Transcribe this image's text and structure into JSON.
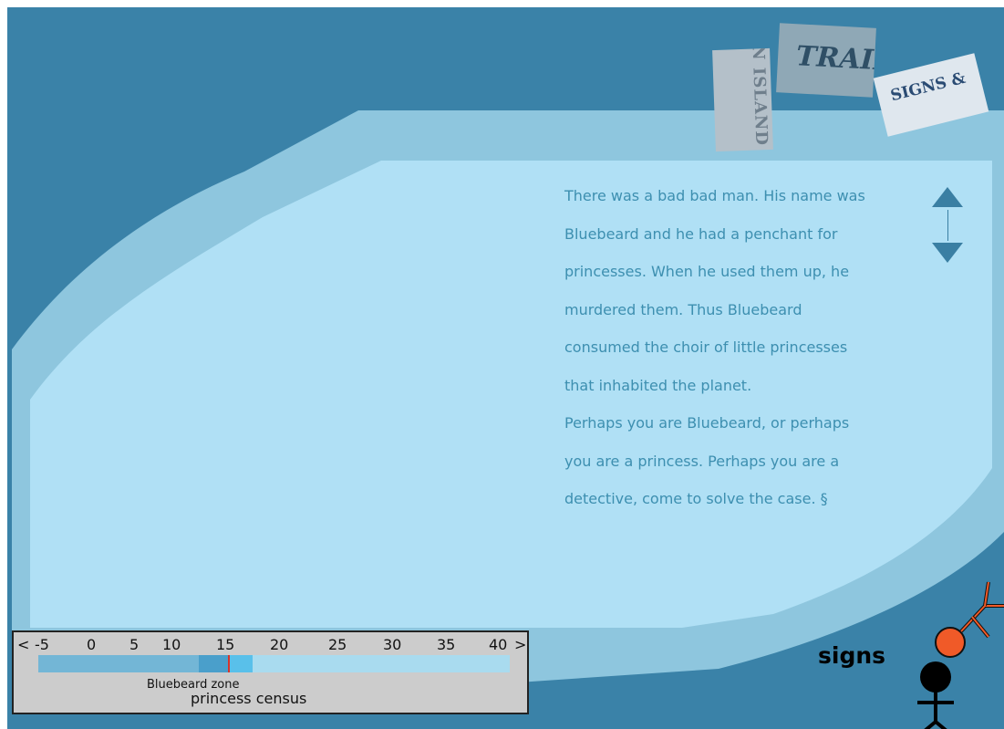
{
  "story": {
    "text": "There was a bad bad man. His name was\nBluebeard and he had a penchant for\nprincesses. When he used them up, he\nmurdered them. Thus Bluebeard\nconsumed the choir of little princesses\nthat inhabited the planet.\nPerhaps you are Bluebeard, or perhaps\nyou are a princess. Perhaps you are a\ndetective, come to solve the case. §"
  },
  "tiles": {
    "island": "IN ISLAND",
    "trail": "TRAIL",
    "signs": "SIGNS &"
  },
  "nav": {
    "signs_label": "signs",
    "scroll_up_icon": "triangle-up-icon",
    "scroll_down_icon": "triangle-down-icon"
  },
  "census": {
    "left_arrow": "<",
    "right_arrow": ">",
    "ticks": [
      "-5",
      "0",
      "5",
      "10",
      "15",
      "20",
      "25",
      "30",
      "35",
      "40"
    ],
    "zone_label": "Bluebeard zone",
    "title": "princess census",
    "scale_min": -5,
    "scale_max": 40,
    "zone_start": 10,
    "zone_end": 15,
    "marker_value": 13
  },
  "colors": {
    "background": "#3a82a8",
    "panel_outer": "#8ec6de",
    "panel_inner": "#b0e0f5",
    "story_text": "#3d8fb0",
    "figure_accent": "#f05a28"
  }
}
